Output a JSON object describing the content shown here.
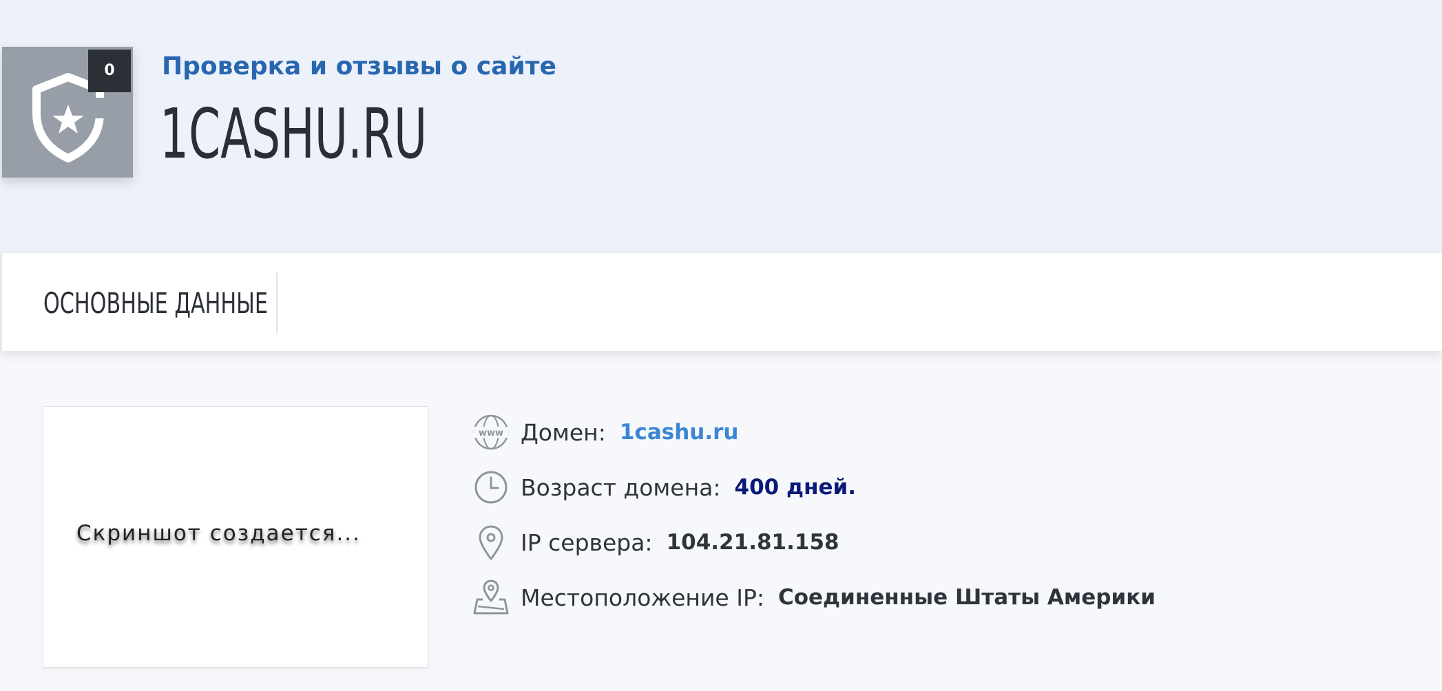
{
  "header": {
    "subtitle": "Проверка и отзывы о сайте",
    "title": "1CASHU.RU",
    "badge_count": "0",
    "badge_icon": "shield-star-icon"
  },
  "tabs": [
    {
      "label": "ОСНОВНЫЕ ДАННЫЕ"
    }
  ],
  "screenshot_placeholder": "Скриншот создается...",
  "info": {
    "domain": {
      "label": "Домен:",
      "value": "1cashu.ru",
      "icon": "www-globe-icon"
    },
    "age": {
      "label": "Возраст домена:",
      "value": "400 дней.",
      "icon": "clock-icon"
    },
    "ip": {
      "label": "IP сервера:",
      "value": "104.21.81.158",
      "icon": "location-pin-icon"
    },
    "location": {
      "label": "Местоположение IP:",
      "value": "Соединенные Штаты Америки",
      "icon": "map-pin-icon"
    }
  },
  "colors": {
    "header_bg": "#edf1fa",
    "subtitle": "#2867b0",
    "link": "#3a86d4",
    "age_value": "#0a1a78",
    "badge_bg": "#979ea8",
    "count_bg": "#2b3036"
  }
}
